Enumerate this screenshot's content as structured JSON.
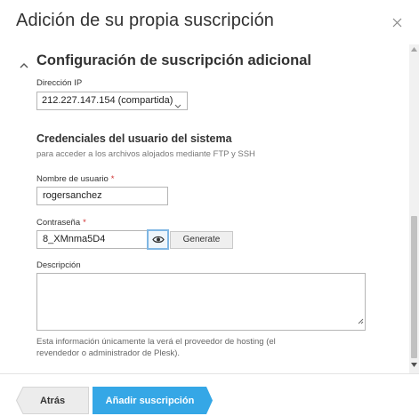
{
  "dialog": {
    "title": "Adición de su propia suscripción",
    "close_icon": "close-icon"
  },
  "section": {
    "title": "Configuración de suscripción adicional",
    "chevron_icon": "chevron-up-icon"
  },
  "ip": {
    "label": "Dirección IP",
    "selected": "212.227.147.154 (compartida)"
  },
  "credentials": {
    "heading": "Credenciales del usuario del sistema",
    "hint": "para acceder a los archivos alojados mediante FTP y SSH"
  },
  "username": {
    "label": "Nombre de usuario",
    "required_mark": "*",
    "value": "rogersanchez"
  },
  "password": {
    "label": "Contraseña",
    "required_mark": "*",
    "value": "8_XMnma5D4",
    "show_icon": "eye-icon",
    "generate_label": "Generate"
  },
  "description": {
    "label": "Descripción",
    "value": "",
    "note": "Esta información únicamente la verá el proveedor de hosting (el revendedor o administrador de Plesk)."
  },
  "footer": {
    "back_label": "Atrás",
    "add_label": "Añadir suscripción"
  },
  "colors": {
    "accent": "#35a7e6",
    "required": "#d02e2e",
    "back_bg": "#ececec"
  }
}
